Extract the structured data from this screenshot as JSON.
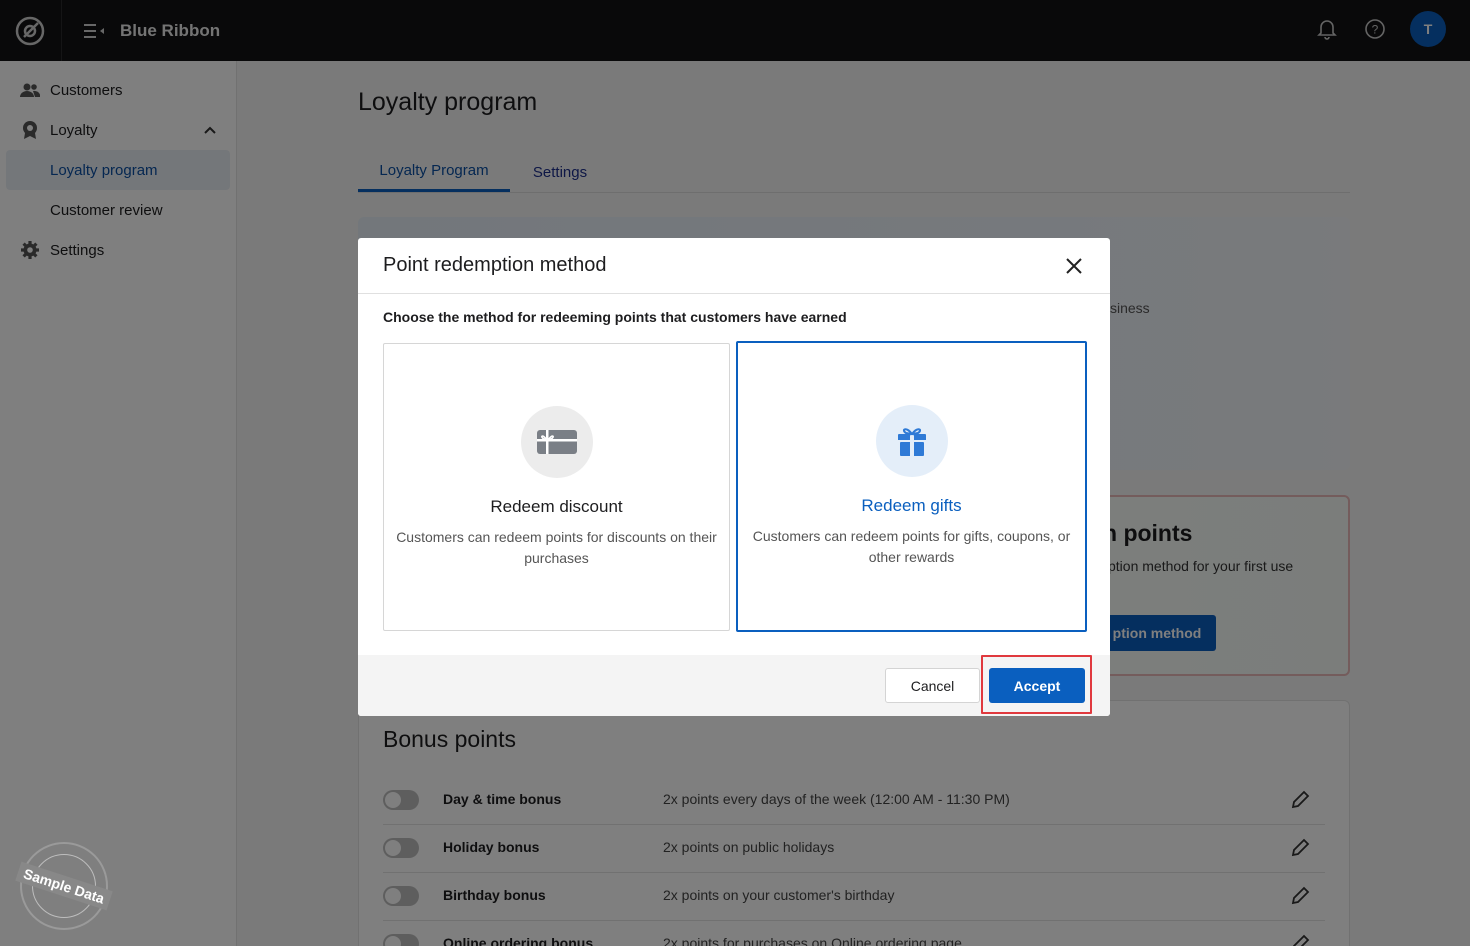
{
  "app": {
    "brand": "Blue Ribbon",
    "avatar_initial": "T"
  },
  "sidebar": {
    "items": [
      {
        "label": "Customers",
        "icon": "users-icon"
      },
      {
        "label": "Loyalty",
        "icon": "award-icon"
      },
      {
        "label": "Loyalty program",
        "active": true
      },
      {
        "label": "Customer review"
      },
      {
        "label": "Settings",
        "icon": "gear-icon"
      }
    ],
    "sample_stamp": "Sample Data"
  },
  "main": {
    "title": "Loyalty program",
    "tabs": [
      {
        "label": "Loyalty Program",
        "active": true
      },
      {
        "label": "Settings"
      }
    ],
    "banner_fragment": "siness",
    "points_panel": {
      "title_fragment": "n points",
      "subtitle_fragment": "ption method for your first use",
      "button_fragment": "ption method"
    },
    "bonus": {
      "title": "Bonus points",
      "rows": [
        {
          "name": "Day & time bonus",
          "desc": "2x points every days of the week (12:00 AM - 11:30 PM)"
        },
        {
          "name": "Holiday bonus",
          "desc": "2x points on public holidays"
        },
        {
          "name": "Birthday bonus",
          "desc": "2x points on your customer's birthday"
        },
        {
          "name": "Online ordering bonus",
          "desc": "2x points for purchases on Online ordering page"
        }
      ]
    }
  },
  "modal": {
    "title": "Point redemption method",
    "description": "Choose the method for redeeming points that customers have earned",
    "options": [
      {
        "title": "Redeem discount",
        "desc": "Customers can redeem points for discounts on their purchases",
        "icon": "gift-card-icon",
        "selected": false
      },
      {
        "title": "Redeem gifts",
        "desc": "Customers can redeem points for gifts, coupons, or other rewards",
        "icon": "gift-icon",
        "selected": true
      }
    ],
    "cancel_label": "Cancel",
    "accept_label": "Accept"
  },
  "colors": {
    "accent": "#0a5fbf",
    "topbar": "#121314",
    "highlight": "#e0393e"
  }
}
